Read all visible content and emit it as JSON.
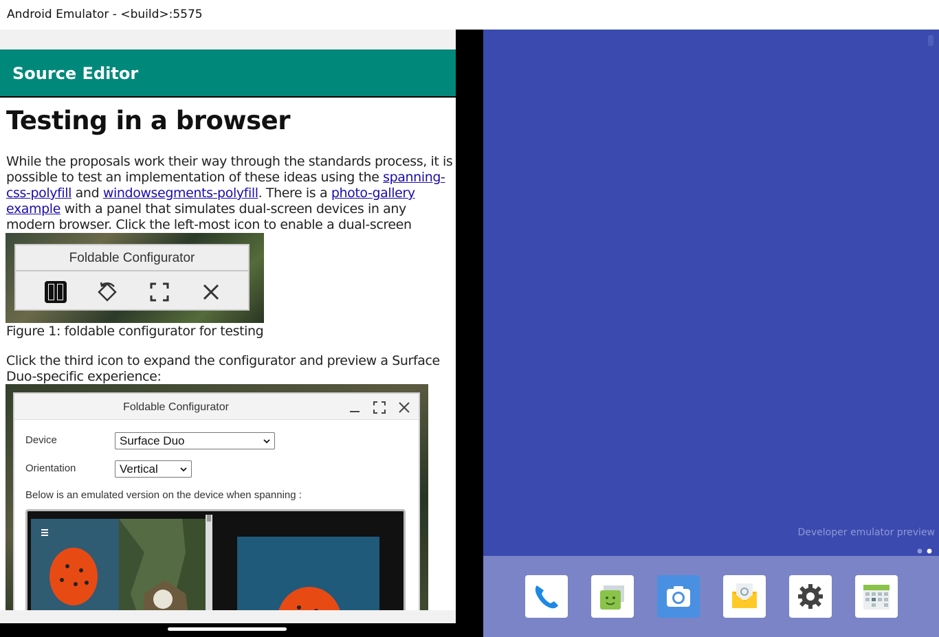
{
  "window": {
    "title": "Android Emulator - <build>:5575"
  },
  "left_screen": {
    "app_title": "Source Editor",
    "article": {
      "heading": "Testing in a browser",
      "para1_a": "While the proposals work their way through the standards process, it is possible to test an implementation of these ideas using the ",
      "link1": "spanning-css-polyfill",
      "para1_b": " and ",
      "link2": "windowsegments-polyfill",
      "para1_c": ". There is a ",
      "link3": "photo-gallery example",
      "para1_d": " with a panel that simulates dual-screen devices in any modern browser. Click the left-most icon to enable a dual-screen experience in the browser:",
      "figure1": {
        "panel_title": "Foldable Configurator",
        "icons": [
          "dual-screen-icon",
          "rotate-icon",
          "expand-icon",
          "close-icon"
        ]
      },
      "caption1": "Figure 1: foldable configurator for testing",
      "para2": "Click the third icon to expand the configurator and preview a Surface Duo-specific experience:",
      "figure2": {
        "window_title": "Foldable Configurator",
        "device_label": "Device",
        "device_value": "Surface Duo",
        "orientation_label": "Orientation",
        "orientation_value": "Vertical",
        "note": "Below is an emulated version on the device when spanning :"
      }
    }
  },
  "right_screen": {
    "preview_label": "Developer emulator preview",
    "dock_apps": [
      "phone-icon",
      "messages-icon",
      "camera-icon",
      "email-icon",
      "settings-icon",
      "calendar-icon"
    ]
  },
  "colors": {
    "app_bar": "#00897b",
    "desktop_bg": "#3b4aae",
    "dock_bg": "#7a84c6",
    "link": "#1a0dab"
  }
}
